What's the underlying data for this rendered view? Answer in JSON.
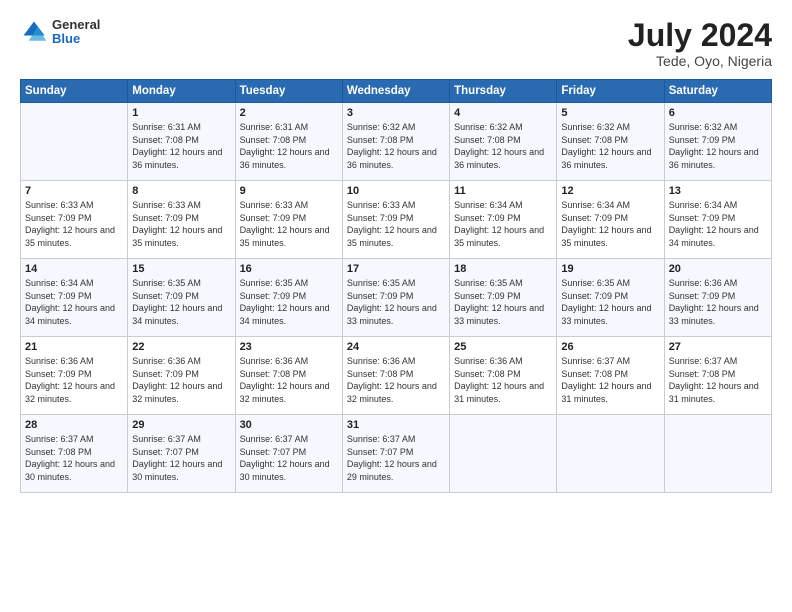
{
  "header": {
    "logo_general": "General",
    "logo_blue": "Blue",
    "title": "July 2024",
    "location": "Tede, Oyo, Nigeria"
  },
  "days_of_week": [
    "Sunday",
    "Monday",
    "Tuesday",
    "Wednesday",
    "Thursday",
    "Friday",
    "Saturday"
  ],
  "weeks": [
    [
      {
        "num": "",
        "sunrise": "",
        "sunset": "",
        "daylight": ""
      },
      {
        "num": "1",
        "sunrise": "6:31 AM",
        "sunset": "7:08 PM",
        "daylight": "12 hours and 36 minutes."
      },
      {
        "num": "2",
        "sunrise": "6:31 AM",
        "sunset": "7:08 PM",
        "daylight": "12 hours and 36 minutes."
      },
      {
        "num": "3",
        "sunrise": "6:32 AM",
        "sunset": "7:08 PM",
        "daylight": "12 hours and 36 minutes."
      },
      {
        "num": "4",
        "sunrise": "6:32 AM",
        "sunset": "7:08 PM",
        "daylight": "12 hours and 36 minutes."
      },
      {
        "num": "5",
        "sunrise": "6:32 AM",
        "sunset": "7:08 PM",
        "daylight": "12 hours and 36 minutes."
      },
      {
        "num": "6",
        "sunrise": "6:32 AM",
        "sunset": "7:09 PM",
        "daylight": "12 hours and 36 minutes."
      }
    ],
    [
      {
        "num": "7",
        "sunrise": "6:33 AM",
        "sunset": "7:09 PM",
        "daylight": "12 hours and 35 minutes."
      },
      {
        "num": "8",
        "sunrise": "6:33 AM",
        "sunset": "7:09 PM",
        "daylight": "12 hours and 35 minutes."
      },
      {
        "num": "9",
        "sunrise": "6:33 AM",
        "sunset": "7:09 PM",
        "daylight": "12 hours and 35 minutes."
      },
      {
        "num": "10",
        "sunrise": "6:33 AM",
        "sunset": "7:09 PM",
        "daylight": "12 hours and 35 minutes."
      },
      {
        "num": "11",
        "sunrise": "6:34 AM",
        "sunset": "7:09 PM",
        "daylight": "12 hours and 35 minutes."
      },
      {
        "num": "12",
        "sunrise": "6:34 AM",
        "sunset": "7:09 PM",
        "daylight": "12 hours and 35 minutes."
      },
      {
        "num": "13",
        "sunrise": "6:34 AM",
        "sunset": "7:09 PM",
        "daylight": "12 hours and 34 minutes."
      }
    ],
    [
      {
        "num": "14",
        "sunrise": "6:34 AM",
        "sunset": "7:09 PM",
        "daylight": "12 hours and 34 minutes."
      },
      {
        "num": "15",
        "sunrise": "6:35 AM",
        "sunset": "7:09 PM",
        "daylight": "12 hours and 34 minutes."
      },
      {
        "num": "16",
        "sunrise": "6:35 AM",
        "sunset": "7:09 PM",
        "daylight": "12 hours and 34 minutes."
      },
      {
        "num": "17",
        "sunrise": "6:35 AM",
        "sunset": "7:09 PM",
        "daylight": "12 hours and 33 minutes."
      },
      {
        "num": "18",
        "sunrise": "6:35 AM",
        "sunset": "7:09 PM",
        "daylight": "12 hours and 33 minutes."
      },
      {
        "num": "19",
        "sunrise": "6:35 AM",
        "sunset": "7:09 PM",
        "daylight": "12 hours and 33 minutes."
      },
      {
        "num": "20",
        "sunrise": "6:36 AM",
        "sunset": "7:09 PM",
        "daylight": "12 hours and 33 minutes."
      }
    ],
    [
      {
        "num": "21",
        "sunrise": "6:36 AM",
        "sunset": "7:09 PM",
        "daylight": "12 hours and 32 minutes."
      },
      {
        "num": "22",
        "sunrise": "6:36 AM",
        "sunset": "7:09 PM",
        "daylight": "12 hours and 32 minutes."
      },
      {
        "num": "23",
        "sunrise": "6:36 AM",
        "sunset": "7:08 PM",
        "daylight": "12 hours and 32 minutes."
      },
      {
        "num": "24",
        "sunrise": "6:36 AM",
        "sunset": "7:08 PM",
        "daylight": "12 hours and 32 minutes."
      },
      {
        "num": "25",
        "sunrise": "6:36 AM",
        "sunset": "7:08 PM",
        "daylight": "12 hours and 31 minutes."
      },
      {
        "num": "26",
        "sunrise": "6:37 AM",
        "sunset": "7:08 PM",
        "daylight": "12 hours and 31 minutes."
      },
      {
        "num": "27",
        "sunrise": "6:37 AM",
        "sunset": "7:08 PM",
        "daylight": "12 hours and 31 minutes."
      }
    ],
    [
      {
        "num": "28",
        "sunrise": "6:37 AM",
        "sunset": "7:08 PM",
        "daylight": "12 hours and 30 minutes."
      },
      {
        "num": "29",
        "sunrise": "6:37 AM",
        "sunset": "7:07 PM",
        "daylight": "12 hours and 30 minutes."
      },
      {
        "num": "30",
        "sunrise": "6:37 AM",
        "sunset": "7:07 PM",
        "daylight": "12 hours and 30 minutes."
      },
      {
        "num": "31",
        "sunrise": "6:37 AM",
        "sunset": "7:07 PM",
        "daylight": "12 hours and 29 minutes."
      },
      {
        "num": "",
        "sunrise": "",
        "sunset": "",
        "daylight": ""
      },
      {
        "num": "",
        "sunrise": "",
        "sunset": "",
        "daylight": ""
      },
      {
        "num": "",
        "sunrise": "",
        "sunset": "",
        "daylight": ""
      }
    ]
  ]
}
